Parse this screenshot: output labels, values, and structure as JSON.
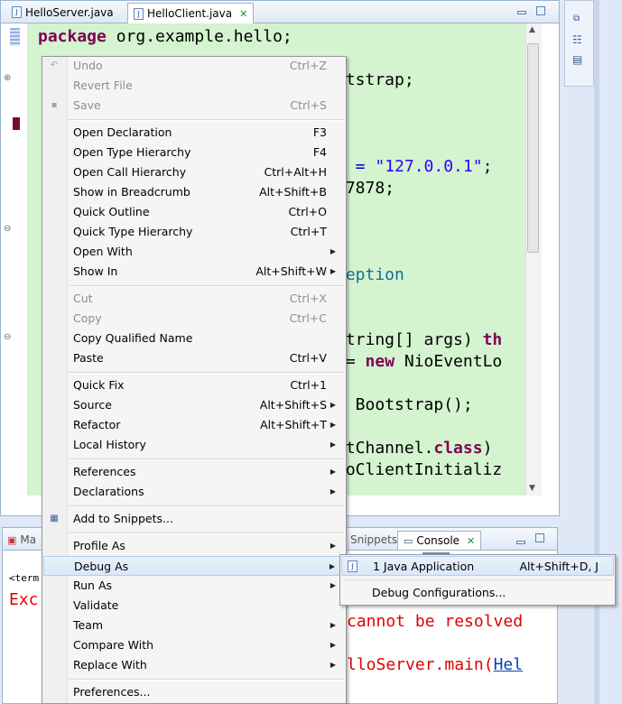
{
  "editor": {
    "tabs": [
      {
        "label": "HelloServer.java",
        "active": false
      },
      {
        "label": "HelloClient.java",
        "active": true
      }
    ],
    "code_lines": {
      "l1_kw": "package",
      "l1_rest": " org.example.hello;",
      "l2": "otstrap;",
      "l3_rest1": "t = ",
      "l3_str": "\"127.0.0.1\"",
      "l3_rest2": ";",
      "l4": " 7878;",
      "l5": "ception",
      "l6a": "String[] args) ",
      "l6b": "th",
      "l7a": " = ",
      "l7kw": "new",
      "l7b": " NioEventLo",
      "l8a": "w",
      "l8b": " Bootstrap();",
      "l9a": "etChannel.",
      "l9kw": "class",
      "l9b": ")",
      "l10": "loClientInitializ"
    }
  },
  "console": {
    "tabs": {
      "markers": "Ma",
      "snippets": "Snippets",
      "console": "Console"
    },
    "term": "<term",
    "exc": "Exc",
    "err1": "cannot be resolved",
    "err2_a": "lloServer.main(",
    "err2_link": "Hel"
  },
  "context_menu": {
    "items": [
      {
        "label": "Undo",
        "shortcut": "Ctrl+Z",
        "disabled": true
      },
      {
        "label": "Revert File",
        "shortcut": "",
        "disabled": true
      },
      {
        "label": "Save",
        "shortcut": "Ctrl+S",
        "disabled": true
      },
      {
        "label": "Open Declaration",
        "shortcut": "F3"
      },
      {
        "label": "Open Type Hierarchy",
        "shortcut": "F4"
      },
      {
        "label": "Open Call Hierarchy",
        "shortcut": "Ctrl+Alt+H"
      },
      {
        "label": "Show in Breadcrumb",
        "shortcut": "Alt+Shift+B"
      },
      {
        "label": "Quick Outline",
        "shortcut": "Ctrl+O"
      },
      {
        "label": "Quick Type Hierarchy",
        "shortcut": "Ctrl+T"
      },
      {
        "label": "Open With",
        "shortcut": ""
      },
      {
        "label": "Show In",
        "shortcut": "Alt+Shift+W"
      },
      {
        "label": "Cut",
        "shortcut": "Ctrl+X",
        "disabled": true
      },
      {
        "label": "Copy",
        "shortcut": "Ctrl+C",
        "disabled": true
      },
      {
        "label": "Copy Qualified Name",
        "shortcut": ""
      },
      {
        "label": "Paste",
        "shortcut": "Ctrl+V"
      },
      {
        "label": "Quick Fix",
        "shortcut": "Ctrl+1"
      },
      {
        "label": "Source",
        "shortcut": "Alt+Shift+S"
      },
      {
        "label": "Refactor",
        "shortcut": "Alt+Shift+T"
      },
      {
        "label": "Local History",
        "shortcut": ""
      },
      {
        "label": "References",
        "shortcut": ""
      },
      {
        "label": "Declarations",
        "shortcut": ""
      },
      {
        "label": "Add to Snippets...",
        "shortcut": ""
      },
      {
        "label": "Profile As",
        "shortcut": ""
      },
      {
        "label": "Debug As",
        "shortcut": ""
      },
      {
        "label": "Run As",
        "shortcut": ""
      },
      {
        "label": "Validate",
        "shortcut": ""
      },
      {
        "label": "Team",
        "shortcut": ""
      },
      {
        "label": "Compare With",
        "shortcut": ""
      },
      {
        "label": "Replace With",
        "shortcut": ""
      },
      {
        "label": "Preferences...",
        "shortcut": ""
      }
    ]
  },
  "debug_submenu": {
    "items": [
      {
        "label": "1 Java Application",
        "shortcut": "Alt+Shift+D, J"
      },
      {
        "label": "Debug Configurations...",
        "shortcut": ""
      }
    ]
  }
}
